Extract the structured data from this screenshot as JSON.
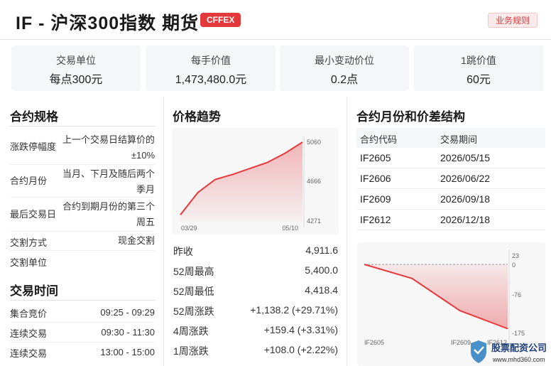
{
  "header": {
    "title": "IF - 沪深300指数 期货",
    "badge": "CFFEX",
    "rules_button": "业务规则"
  },
  "stats": [
    {
      "label": "交易单位",
      "value": "每点300元"
    },
    {
      "label": "每手价值",
      "value": "1,473,480.0元"
    },
    {
      "label": "最小变动价位",
      "value": "0.2点"
    },
    {
      "label": "1跳价值",
      "value": "60元"
    }
  ],
  "spec": {
    "title": "合约规格",
    "rows": [
      {
        "label": "涨跌停幅度",
        "value": "上一个交易日结算价的±10%"
      },
      {
        "label": "合约月份",
        "value": "当月、下月及随后两个季月"
      },
      {
        "label": "最后交易日",
        "value": "合约到期月份的第三个周五"
      },
      {
        "label": "交割方式",
        "value": "现金交割"
      },
      {
        "label": "交割单位",
        "value": ""
      }
    ]
  },
  "trading_time": {
    "title": "交易时间",
    "rows": [
      {
        "label": "集合竞价",
        "value": "09:25 - 09:29"
      },
      {
        "label": "连续交易",
        "value": "09:30 - 11:30"
      },
      {
        "label": "连续交易",
        "value": "13:00 - 15:00"
      }
    ]
  },
  "trend": {
    "title": "价格趋势",
    "stats": [
      {
        "label": "昨收",
        "value": "4,911.6"
      },
      {
        "label": "52周最高",
        "value": "5,400.0"
      },
      {
        "label": "52周最低",
        "value": "4,418.4"
      },
      {
        "label": "52周涨跌",
        "value": "+1,138.2 (+29.71%)"
      },
      {
        "label": "4周涨跌",
        "value": "+159.4 (+3.31%)"
      },
      {
        "label": "1周涨跌",
        "value": "+108.0 (+2.22%)"
      }
    ]
  },
  "structure": {
    "title": "合约月份和价差结构",
    "columns": [
      "合约代码",
      "交易期间"
    ],
    "rows": [
      {
        "code": "IF2605",
        "date": "2026/05/15"
      },
      {
        "code": "IF2606",
        "date": "2026/06/22"
      },
      {
        "code": "IF2609",
        "date": "2026/09/18"
      },
      {
        "code": "IF2612",
        "date": "2026/12/18"
      }
    ]
  },
  "chart_data": [
    {
      "type": "area",
      "x_labels": [
        "03/29",
        "05/10"
      ],
      "y_ticks": [
        "5060",
        "4666",
        "4271"
      ],
      "ylim": [
        4271,
        5060
      ],
      "values": [
        4340,
        4560,
        4690,
        4740,
        4800,
        4860,
        4950,
        5060
      ],
      "color": "#e4393c"
    },
    {
      "type": "area",
      "categories": [
        "IF2605",
        "IF2606",
        "IF2609",
        "IF2612"
      ],
      "x_labels": [
        "IF2605",
        "IF2609",
        "IF2612"
      ],
      "y_ticks": [
        "23",
        "0",
        "-76",
        "-175"
      ],
      "ylim": [
        -175,
        23
      ],
      "values": [
        0,
        -35,
        -115,
        -160
      ],
      "baseline": 0,
      "color": "#e4393c"
    }
  ],
  "watermark": {
    "text": "股票配资公司",
    "url_text": "www.mhd360.com"
  }
}
